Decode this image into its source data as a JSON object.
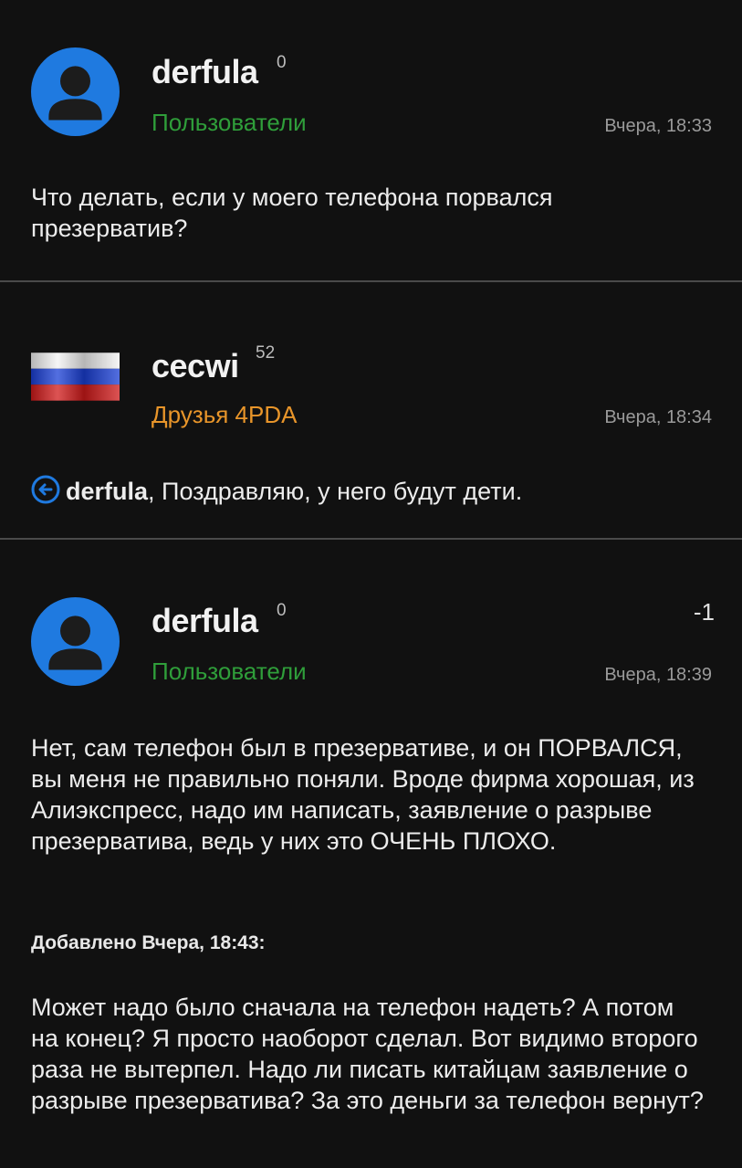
{
  "posts": [
    {
      "username": "derfula",
      "reputation": "0",
      "group": "Пользователи",
      "time": "Вчера, 18:33",
      "text": "Что делать, если у моего телефона порвался презерватив?"
    },
    {
      "username": "cecwi",
      "reputation": "52",
      "group": "Друзья 4PDA",
      "time": "Вчера, 18:34",
      "mention": "derfula",
      "text": ", Поздравляю, у него будут дети."
    },
    {
      "username": "derfula",
      "reputation": "0",
      "group": "Пользователи",
      "time": "Вчера, 18:39",
      "vote": "-1",
      "text": "Нет, сам телефон был в презервативе, и он ПОРВАЛСЯ, вы меня не правильно поняли. Вроде фирма хорошая, из Алиэкспресс, надо им написать, заявление о разрыве презерватива, ведь у них это ОЧЕНЬ ПЛОХО.",
      "added_label": "Добавлено Вчера, 18:43:",
      "text2": "Может надо было сначала на телефон надеть? А потом на конец? Я просто наоборот сделал. Вот видимо второго раза не вытерпел. Надо ли писать китайцам заявление о разрыве презерватива? За это деньги за телефон вернут?"
    }
  ],
  "colors": {
    "background": "#111111",
    "group_users": "#2f9e3a",
    "group_friends": "#e8952a",
    "avatar_blue": "#1f7ae0",
    "divider": "#4a4a4a"
  },
  "icons": {
    "default_avatar": "default-avatar-icon",
    "flag_avatar": "russian-flag-avatar",
    "quote": "quote-back-arrow-icon"
  }
}
